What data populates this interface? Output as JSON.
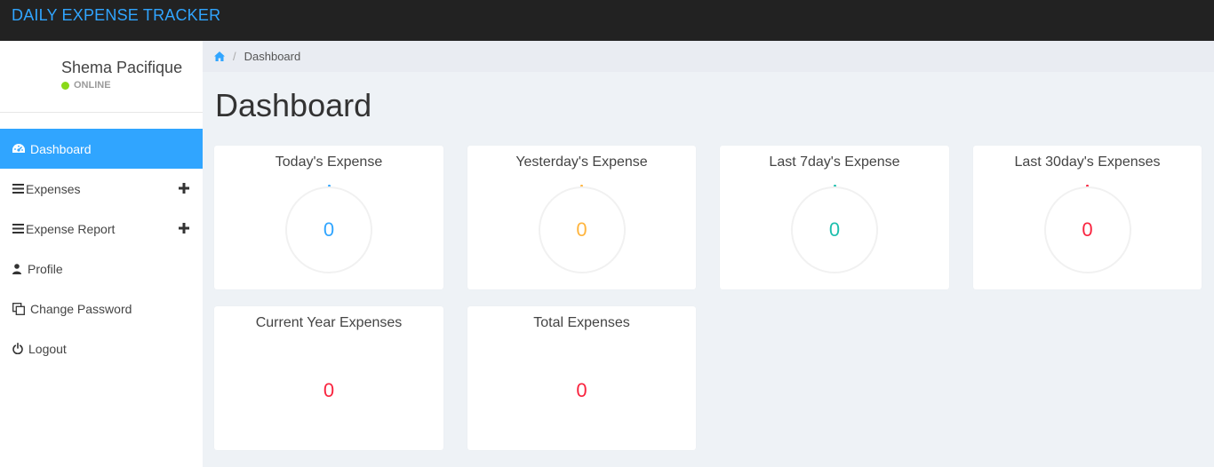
{
  "app": {
    "title": "DAILY EXPENSE TRACKER"
  },
  "user": {
    "name": "Shema Pacifique",
    "status": "ONLINE"
  },
  "menu": {
    "items": [
      {
        "label": "Dashboard",
        "icon": "dashboard-icon",
        "active": true
      },
      {
        "label": "Expenses",
        "icon": "list-icon",
        "expandable": true
      },
      {
        "label": "Expense Report",
        "icon": "list-icon",
        "expandable": true
      },
      {
        "label": "Profile",
        "icon": "user-icon"
      },
      {
        "label": "Change Password",
        "icon": "copy-icon"
      },
      {
        "label": "Logout",
        "icon": "power-icon"
      }
    ]
  },
  "breadcrumb": {
    "current": "Dashboard"
  },
  "page": {
    "title": "Dashboard"
  },
  "cards": [
    {
      "title": "Today's Expense",
      "value": "0",
      "color": "#30a5ff"
    },
    {
      "title": "Yesterday's Expense",
      "value": "0",
      "color": "#ffb53e"
    },
    {
      "title": "Last 7day's Expense",
      "value": "0",
      "color": "#1ebfae"
    },
    {
      "title": "Last 30day's Expenses",
      "value": "0",
      "color": "#f9243f"
    },
    {
      "title": "Current Year Expenses",
      "value": "0",
      "color": "#f9243f"
    },
    {
      "title": "Total Expenses",
      "value": "0",
      "color": "#f9243f"
    }
  ],
  "colors": {
    "accent": "#30a5ff",
    "topbar": "#222222",
    "online": "#8ad919"
  }
}
